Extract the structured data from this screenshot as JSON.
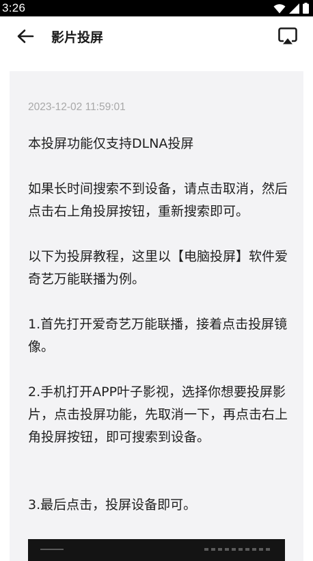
{
  "status_bar": {
    "time": "3:26",
    "icons": [
      "wifi-icon",
      "signal-icon",
      "battery-icon"
    ]
  },
  "app_bar": {
    "title": "影片投屏",
    "back_icon": "arrow-left-icon",
    "cast_icon": "cast-screen-icon"
  },
  "article": {
    "date": "2023-12-02 11:59:01",
    "paragraphs": [
      "本投屏功能仅支持DLNA投屏",
      "如果长时间搜索不到设备，请点击取消，然后点击右上角投屏按钮，重新搜索即可。",
      "以下为投屏教程，这里以【电脑投屏】软件爱奇艺万能联播为例。",
      "1.首先打开爱奇艺万能联播，接着点击投屏镜像。",
      "2.手机打开APP叶子影视，选择你想要投屏影片，点击投屏功能，先取消一下，再点击右上角投屏按钮，即可搜索到设备。",
      "3.最后点击，投屏设备即可。"
    ]
  },
  "colors": {
    "status_bar_bg": "#000000",
    "card_bg": "#f3f3f5",
    "date_text": "#a8a8a8",
    "body_text": "#1f1f1f"
  }
}
